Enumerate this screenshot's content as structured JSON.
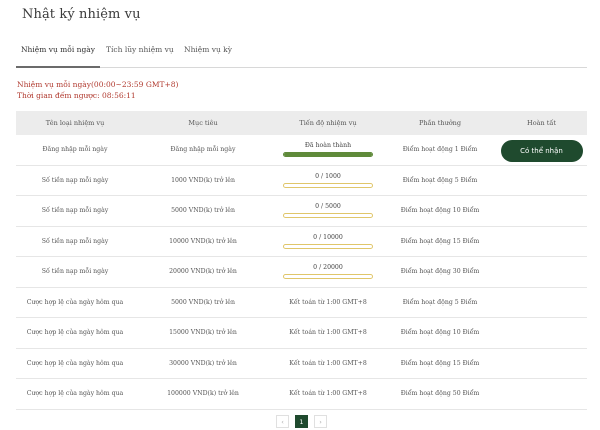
{
  "page": {
    "title": "Nhật ký nhiệm vụ"
  },
  "tabs": [
    {
      "label": "Nhiệm vụ mỗi ngày",
      "active": true
    },
    {
      "label": "Tích lũy nhiệm vụ",
      "active": false
    },
    {
      "label": "Nhiệm vụ kỳ",
      "active": false
    }
  ],
  "notice": {
    "line1": "Nhiệm vụ mỗi ngày(00:00~23:59 GMT+8)",
    "line2": "Thời gian đếm ngược: 08:56:11"
  },
  "colors": {
    "accent": "#1f4a2e",
    "notice": "#b0392e",
    "progress": "#5f8a3a",
    "progress_border": "#e0c66a"
  },
  "table": {
    "headers": [
      "Tên loại nhiệm vụ",
      "Mục tiêu",
      "Tiến độ nhiệm vụ",
      "Phần thưởng",
      "Hoàn tất"
    ],
    "rows": [
      {
        "name": "Đăng nhập mỗi ngày",
        "target": "Đăng nhập mỗi ngày",
        "progress": "Đã hoàn thành",
        "progress_value": 1,
        "reward": "Điểm hoạt động 1 Điểm",
        "action": "Có thể nhận"
      },
      {
        "name": "Số tiền nạp mỗi ngày",
        "target": "1000 VND(k) trở lên",
        "progress": "0 / 1000",
        "progress_value": 0,
        "reward": "Điểm hoạt động 5 Điểm"
      },
      {
        "name": "Số tiền nạp mỗi ngày",
        "target": "5000 VND(k) trở lên",
        "progress": "0 / 5000",
        "progress_value": 0,
        "reward": "Điểm hoạt động 10 Điểm"
      },
      {
        "name": "Số tiền nạp mỗi ngày",
        "target": "10000 VND(k) trở lên",
        "progress": "0 / 10000",
        "progress_value": 0,
        "reward": "Điểm hoạt động 15 Điểm"
      },
      {
        "name": "Số tiền nạp mỗi ngày",
        "target": "20000 VND(k) trở lên",
        "progress": "0 / 20000",
        "progress_value": 0,
        "reward": "Điểm hoạt động 30 Điểm"
      },
      {
        "name": "Cược hợp lệ của ngày hôm qua",
        "target": "5000 VND(k) trở lên",
        "progress": "Kết toán từ 1:00 GMT+8",
        "reward": "Điểm hoạt động 5 Điểm"
      },
      {
        "name": "Cược hợp lệ của ngày hôm qua",
        "target": "15000 VND(k) trở lên",
        "progress": "Kết toán từ 1:00 GMT+8",
        "reward": "Điểm hoạt động 10 Điểm"
      },
      {
        "name": "Cược hợp lệ của ngày hôm qua",
        "target": "30000 VND(k) trở lên",
        "progress": "Kết toán từ 1:00 GMT+8",
        "reward": "Điểm hoạt động 15 Điểm"
      },
      {
        "name": "Cược hợp lệ của ngày hôm qua",
        "target": "100000 VND(k) trở lên",
        "progress": "Kết toán từ 1:00 GMT+8",
        "reward": "Điểm hoạt động 50 Điểm"
      }
    ]
  },
  "pagination": {
    "prev": "‹",
    "current": "1",
    "next": "›"
  }
}
